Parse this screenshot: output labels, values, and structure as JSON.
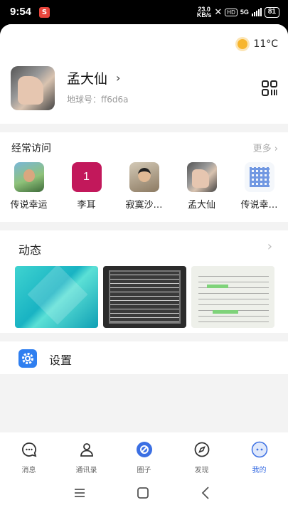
{
  "status_bar": {
    "time": "9:54",
    "app_badge": "SB",
    "net_speed_top": "23.0",
    "net_speed_bottom": "KB/s",
    "hd_label": "HD",
    "net_type": "5G",
    "battery": "81"
  },
  "header": {
    "weather_temp": "11°C",
    "username": "孟大仙",
    "uid_label": "地球号：ff6d6a"
  },
  "frequent": {
    "title": "经常访问",
    "more_label": "更多",
    "contacts": [
      {
        "name": "传说幸运"
      },
      {
        "name": "李耳",
        "initial": "1"
      },
      {
        "name": "寂寞沙…"
      },
      {
        "name": "孟大仙"
      },
      {
        "name": "传说幸…"
      }
    ]
  },
  "moments": {
    "title": "动态"
  },
  "settings": {
    "label": "设置"
  },
  "tabs": [
    {
      "label": "消息",
      "icon": "chat-icon"
    },
    {
      "label": "通讯录",
      "icon": "contacts-icon"
    },
    {
      "label": "圈子",
      "icon": "circle-icon"
    },
    {
      "label": "发现",
      "icon": "compass-icon"
    },
    {
      "label": "我的",
      "icon": "me-icon"
    }
  ],
  "colors": {
    "accent": "#3b6fe3",
    "settings_icon_bg": "#2f7ff0",
    "weather_sun": "#f7b52c"
  }
}
